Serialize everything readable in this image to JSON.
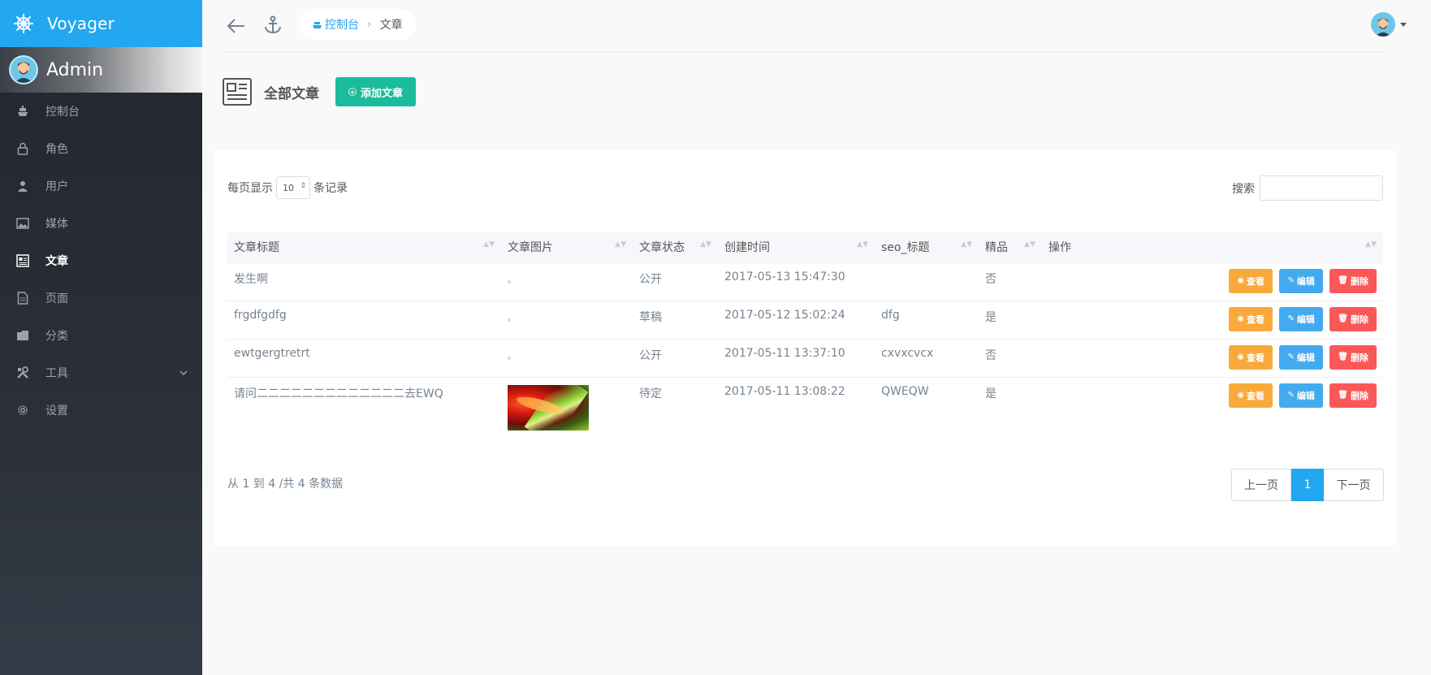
{
  "brand": {
    "name": "Voyager"
  },
  "profile": {
    "name": "Admin"
  },
  "sidebar": {
    "items": [
      {
        "label": "控制台",
        "icon": "boat-icon"
      },
      {
        "label": "角色",
        "icon": "lock-icon"
      },
      {
        "label": "用户",
        "icon": "person-icon"
      },
      {
        "label": "媒体",
        "icon": "image-icon"
      },
      {
        "label": "文章",
        "icon": "newspaper-icon",
        "active": true
      },
      {
        "label": "页面",
        "icon": "file-icon"
      },
      {
        "label": "分类",
        "icon": "folder-icon"
      },
      {
        "label": "工具",
        "icon": "tools-icon",
        "expandable": true
      },
      {
        "label": "设置",
        "icon": "gear-icon"
      }
    ]
  },
  "breadcrumb": {
    "home": "控制台",
    "current": "文章"
  },
  "page": {
    "title": "全部文章",
    "add_label": "添加文章"
  },
  "table_controls": {
    "length_prefix": "每页显示",
    "length_value": "10",
    "length_suffix": "条记录",
    "search_label": "搜索",
    "search_value": ""
  },
  "table": {
    "headers": [
      "文章标题",
      "文章图片",
      "文章状态",
      "创建时间",
      "seo_标题",
      "精品",
      "操作"
    ],
    "rows": [
      {
        "title": "发生啊",
        "image": "。",
        "status": "公开",
        "created": "2017-05-13 15:47:30",
        "seo": "",
        "featured": "否"
      },
      {
        "title": "frgdfgdfg",
        "image": "。",
        "status": "草稿",
        "created": "2017-05-12 15:02:24",
        "seo": "dfg",
        "featured": "是"
      },
      {
        "title": "ewtgergtretrt",
        "image": "。",
        "status": "公开",
        "created": "2017-05-11 13:37:10",
        "seo": "cxvxcvcx",
        "featured": "否"
      },
      {
        "title": "请问二二二二二二二二二二二二二去EWQ",
        "image": "",
        "status": "待定",
        "created": "2017-05-11 13:08:22",
        "seo": "QWEQW",
        "featured": "是"
      }
    ],
    "actions": {
      "view": "查看",
      "edit": "编辑",
      "delete": "删除"
    }
  },
  "footer": {
    "info": "从 1 到 4 /共 4 条数据",
    "prev": "上一页",
    "page": "1",
    "next": "下一页"
  },
  "colors": {
    "brand_blue": "#22a7f0",
    "add_green": "#1abc9c",
    "view_orange": "#f9a93a",
    "edit_blue": "#43aaf0",
    "delete_red": "#fa5858"
  }
}
